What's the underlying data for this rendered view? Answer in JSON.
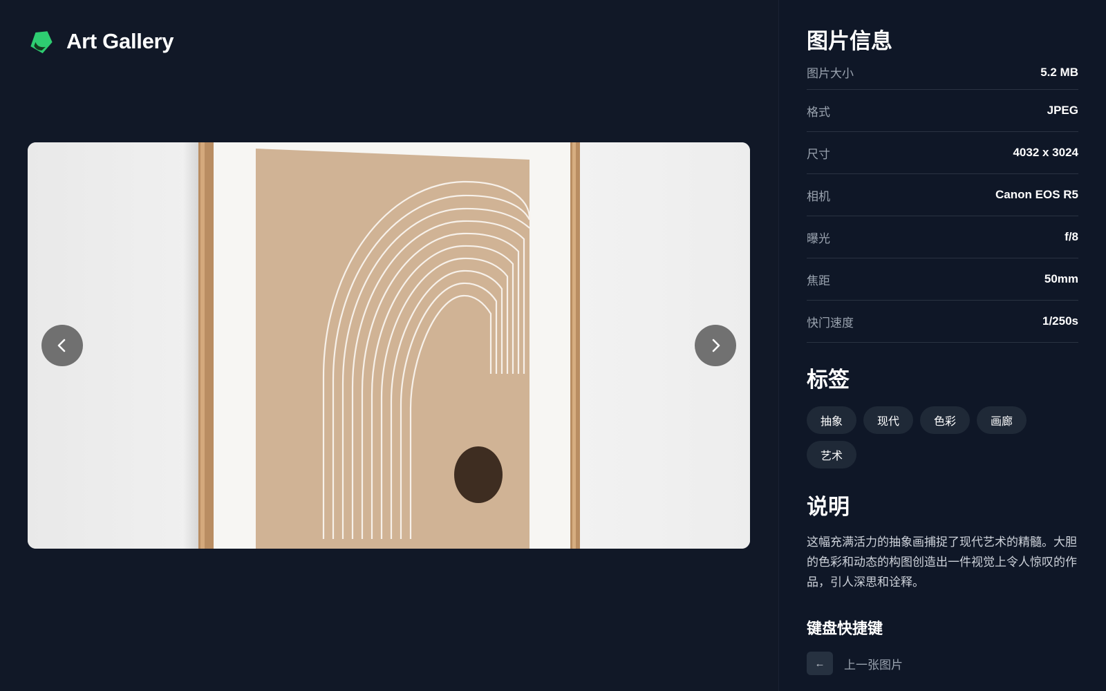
{
  "app": {
    "title": "Art Gallery",
    "accent_color": "#2ecc71",
    "logo_icon": "gem-icon"
  },
  "viewer": {
    "prev_icon": "chevron-left-icon",
    "next_icon": "chevron-right-icon"
  },
  "info": {
    "title": "图片信息",
    "rows": [
      {
        "label": "图片大小",
        "value": "5.2 MB"
      },
      {
        "label": "格式",
        "value": "JPEG"
      },
      {
        "label": "尺寸",
        "value": "4032 x 3024"
      },
      {
        "label": "相机",
        "value": "Canon EOS R5"
      },
      {
        "label": "曝光",
        "value": "f/8"
      },
      {
        "label": "焦距",
        "value": "50mm"
      },
      {
        "label": "快门速度",
        "value": "1/250s"
      }
    ]
  },
  "tags": {
    "title": "标签",
    "items": [
      "抽象",
      "现代",
      "色彩",
      "画廊",
      "艺术"
    ]
  },
  "description": {
    "title": "说明",
    "text": "这幅充满活力的抽象画捕捉了现代艺术的精髓。大胆的色彩和动态的构图创造出一件视觉上令人惊叹的作品，引人深思和诠释。"
  },
  "shortcuts": {
    "title": "键盘快捷键",
    "items": [
      {
        "key": "←",
        "label": "上一张图片"
      }
    ]
  }
}
